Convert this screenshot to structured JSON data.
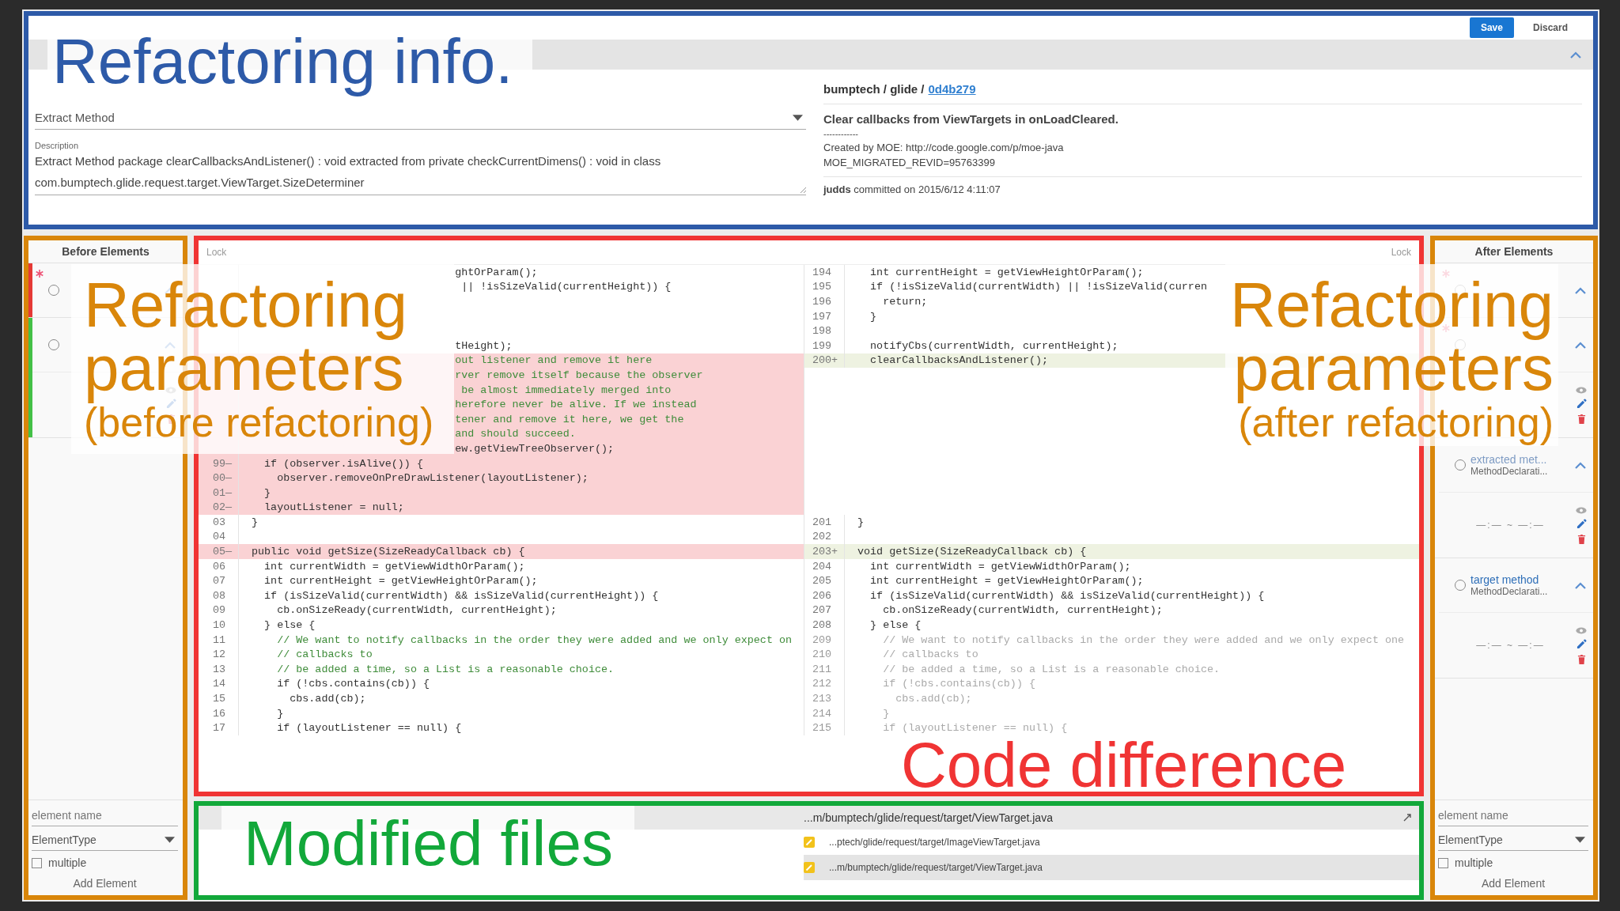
{
  "refactoring_info": {
    "annotation": {
      "title": "Refactoring info.",
      "color": "#2d5aa8"
    },
    "buttons": [
      {
        "label": "Save",
        "kind": "primary"
      },
      {
        "label": "Discard",
        "kind": "flat"
      }
    ],
    "collapse_bar": {
      "expanded": true
    },
    "form": {
      "type_value": "Extract Method",
      "description_label": "Description",
      "description": "Extract Method package clearCallbacksAndListener() : void extracted from private checkCurrentDimens() : void in class com.bumptech.glide.request.target.ViewTarget.SizeDeterminer"
    },
    "commit": {
      "repo": "bumptech / glide /",
      "commit_link": "0d4b279",
      "message": "Clear callbacks from ViewTargets in onLoadCleared.",
      "separator": "------------",
      "details": [
        "Created by MOE: http://code.google.com/p/moe-java",
        "MOE_MIGRATED_REVID=95763399"
      ],
      "footer": "**judds** committed on 2015/6/12 4:11:07"
    }
  },
  "before_elements": {
    "annotation": {
      "title": "Refactoring parameters",
      "subtitle": "(before refactoring)",
      "color": "#d9860a"
    },
    "title": "Before Elements",
    "items": [
      {
        "required": true,
        "selected": false,
        "expanded": true,
        "color": "#e53935"
      },
      {
        "required": false,
        "selected": false,
        "expanded": true,
        "color": "#43c046",
        "locations": [
          {
            "kind": "location"
          }
        ]
      }
    ],
    "name_placeholder": "element name",
    "type_select": "ElementType",
    "multiple": {
      "label": "multiple",
      "checked": false
    },
    "add_button": "Add Element"
  },
  "diff": {
    "annotation": {
      "title": "Code difference",
      "color": "#f03434"
    },
    "lock_left": "Lock",
    "lock_right": "Lock",
    "rows": [
      {
        "left": {
          "text": "                                ghtOrParam();",
          "kind": "code",
          "removed": false
        },
        "right": {
          "num": "194",
          "text": "  int currentHeight = getViewHeightOrParam();",
          "kind": "code",
          "added": false,
          "dimmed": false
        }
      },
      {
        "left": {
          "text": "                                 || !isSizeValid(currentHeight)) {",
          "kind": "code",
          "removed": false
        },
        "right": {
          "num": "195",
          "text": "  if (!isSizeValid(currentWidth) || !isSizeValid(curren",
          "kind": "code",
          "added": false,
          "dimmed": false
        }
      },
      {
        "left": {
          "removed": false
        },
        "right": {
          "num": "196",
          "text": "    return;",
          "kind": "code",
          "added": false,
          "dimmed": false
        }
      },
      {
        "left": {
          "removed": false
        },
        "right": {
          "num": "197",
          "text": "  }",
          "kind": "code",
          "added": false,
          "dimmed": false
        }
      },
      {
        "left": {
          "removed": false
        },
        "right": {
          "num": "198",
          "added": false,
          "dimmed": false
        }
      },
      {
        "left": {
          "text": "                                tHeight);",
          "kind": "code",
          "removed": false
        },
        "right": {
          "num": "199",
          "text": "  notifyCbs(currentWidth, currentHeight);",
          "kind": "code",
          "added": false,
          "dimmed": false
        }
      },
      {
        "left": {
          "text": "                                out listener and remove it here",
          "kind": "comment",
          "removed": true
        },
        "right": {
          "num": "200",
          "mark": "+",
          "text": "  clearCallbacksAndListener();",
          "kind": "code",
          "added": true,
          "dimmed": false
        }
      },
      {
        "left": {
          "text": "                                rver remove itself because the observer",
          "kind": "comment",
          "removed": true
        }
      },
      {
        "left": {
          "text": "                                 be almost immediately merged into",
          "kind": "comment",
          "removed": true
        }
      },
      {
        "left": {
          "text": "                                herefore never be alive. If we instead",
          "kind": "comment",
          "removed": true
        }
      },
      {
        "left": {
          "text": "                                tener and remove it here, we get the",
          "kind": "comment",
          "removed": true
        }
      },
      {
        "left": {
          "text": "                                and should succeed.",
          "kind": "comment",
          "removed": true
        }
      },
      {
        "left": {
          "text": "                                ew.getViewTreeObserver();",
          "kind": "code",
          "removed": true
        }
      },
      {
        "left": {
          "num": "99",
          "mark": "—",
          "text": "  if (observer.isAlive()) {",
          "kind": "code",
          "removed": true
        }
      },
      {
        "left": {
          "num": "00",
          "mark": "—",
          "text": "    observer.removeOnPreDrawListener(layoutListener);",
          "kind": "code",
          "removed": true
        }
      },
      {
        "left": {
          "num": "01",
          "mark": "—",
          "text": "  }",
          "kind": "code",
          "removed": true
        }
      },
      {
        "left": {
          "num": "02",
          "mark": "—",
          "text": "  layoutListener = null;",
          "kind": "code",
          "removed": true
        }
      },
      {
        "left": {
          "num": "03",
          "text": "}",
          "kind": "code",
          "removed": false
        },
        "right": {
          "num": "201",
          "text": "}",
          "kind": "code",
          "added": false,
          "dimmed": false
        }
      },
      {
        "left": {
          "num": "04",
          "removed": false
        },
        "right": {
          "num": "202",
          "added": false,
          "dimmed": false
        }
      },
      {
        "left": {
          "num": "05",
          "mark": "—",
          "text": "public void getSize(SizeReadyCallback cb) {",
          "kind": "code",
          "removed": true
        },
        "right": {
          "num": "203",
          "mark": "+",
          "text": "void getSize(SizeReadyCallback cb) {",
          "kind": "code",
          "added": true,
          "dimmed": false
        }
      },
      {
        "left": {
          "num": "06",
          "text": "  int currentWidth = getViewWidthOrParam();",
          "kind": "code",
          "removed": false
        },
        "right": {
          "num": "204",
          "text": "  int currentWidth = getViewWidthOrParam();",
          "kind": "code",
          "added": false,
          "dimmed": false
        }
      },
      {
        "left": {
          "num": "07",
          "text": "  int currentHeight = getViewHeightOrParam();",
          "kind": "code",
          "removed": false
        },
        "right": {
          "num": "205",
          "text": "  int currentHeight = getViewHeightOrParam();",
          "kind": "code",
          "added": false,
          "dimmed": false
        }
      },
      {
        "left": {
          "num": "08",
          "text": "  if (isSizeValid(currentWidth) && isSizeValid(currentHeight)) {",
          "kind": "code",
          "removed": false
        },
        "right": {
          "num": "206",
          "text": "  if (isSizeValid(currentWidth) && isSizeValid(currentHeight)) {",
          "kind": "code",
          "added": false,
          "dimmed": false
        }
      },
      {
        "left": {
          "num": "09",
          "text": "    cb.onSizeReady(currentWidth, currentHeight);",
          "kind": "code",
          "removed": false
        },
        "right": {
          "num": "207",
          "text": "    cb.onSizeReady(currentWidth, currentHeight);",
          "kind": "code",
          "added": false,
          "dimmed": false
        }
      },
      {
        "left": {
          "num": "10",
          "text": "  } else {",
          "kind": "code",
          "removed": false
        },
        "right": {
          "num": "208",
          "text": "  } else {",
          "kind": "code",
          "added": false,
          "dimmed": false
        }
      },
      {
        "left": {
          "num": "11",
          "text": "    // We want to notify callbacks in the order they were added and we only expect on",
          "kind": "comment",
          "removed": false
        },
        "right": {
          "num": "209",
          "text": "    // We want to notify callbacks in the order they were added and we only expect one",
          "kind": "comment",
          "added": false,
          "dimmed": true
        }
      },
      {
        "left": {
          "num": "12",
          "text": "    // callbacks to",
          "kind": "comment",
          "removed": false
        },
        "right": {
          "num": "210",
          "text": "    // callbacks to",
          "kind": "comment",
          "added": false,
          "dimmed": true
        }
      },
      {
        "left": {
          "num": "13",
          "text": "    // be added a time, so a List is a reasonable choice.",
          "kind": "comment",
          "removed": false
        },
        "right": {
          "num": "211",
          "text": "    // be added a time, so a List is a reasonable choice.",
          "kind": "comment",
          "added": false,
          "dimmed": true
        }
      },
      {
        "left": {
          "num": "14",
          "text": "    if (!cbs.contains(cb)) {",
          "kind": "code",
          "removed": false
        },
        "right": {
          "num": "212",
          "text": "    if (!cbs.contains(cb)) {",
          "kind": "code",
          "added": false,
          "dimmed": true
        }
      },
      {
        "left": {
          "num": "15",
          "text": "      cbs.add(cb);",
          "kind": "code",
          "removed": false
        },
        "right": {
          "num": "213",
          "text": "      cbs.add(cb);",
          "kind": "code",
          "added": false,
          "dimmed": true
        }
      },
      {
        "left": {
          "num": "16",
          "text": "    }",
          "kind": "code",
          "removed": false
        },
        "right": {
          "num": "214",
          "text": "    }",
          "kind": "code",
          "added": false,
          "dimmed": true
        }
      },
      {
        "left": {
          "num": "17",
          "text": "    if (layoutListener == null) {",
          "kind": "code",
          "removed": false
        },
        "right": {
          "num": "215",
          "text": "    if (layoutListener == null) {",
          "kind": "code",
          "added": false,
          "dimmed": true
        }
      }
    ]
  },
  "modified_files": {
    "annotation": {
      "title": "Modified files",
      "color": "#12a83a"
    },
    "header_right": "...m/bumptech/glide/request/target/ViewTarget.java",
    "files": [
      {
        "right": "...ptech/glide/request/target/ImageViewTarget.java",
        "selected": false
      },
      {
        "right": "...m/bumptech/glide/request/target/ViewTarget.java",
        "selected": true
      }
    ]
  },
  "after_elements": {
    "annotation": {
      "title": "Refactoring parameters",
      "subtitle": "(after refactoring)",
      "color": "#d9860a"
    },
    "title": "After Elements",
    "items": [
      {
        "required": true,
        "selected": false,
        "expanded": true
      },
      {
        "required": true,
        "selected": false,
        "expanded": true,
        "locations": [
          {
            "kind": "location"
          }
        ]
      },
      {
        "name": "extracted met...",
        "type": "MethodDeclarati...",
        "required": false,
        "selected": false,
        "expanded": true,
        "active": false,
        "locations": [
          {
            "kind": "location",
            "range": "—:— ~ —:—"
          }
        ]
      },
      {
        "name": "target method",
        "type": "MethodDeclarati...",
        "required": false,
        "selected": false,
        "expanded": true,
        "active": true,
        "locations": [
          {
            "kind": "location",
            "range": "—:— ~ —:—"
          }
        ]
      }
    ],
    "name_placeholder": "element name",
    "type_select": "ElementType",
    "multiple": {
      "label": "multiple",
      "checked": false
    },
    "add_button": "Add Element"
  }
}
